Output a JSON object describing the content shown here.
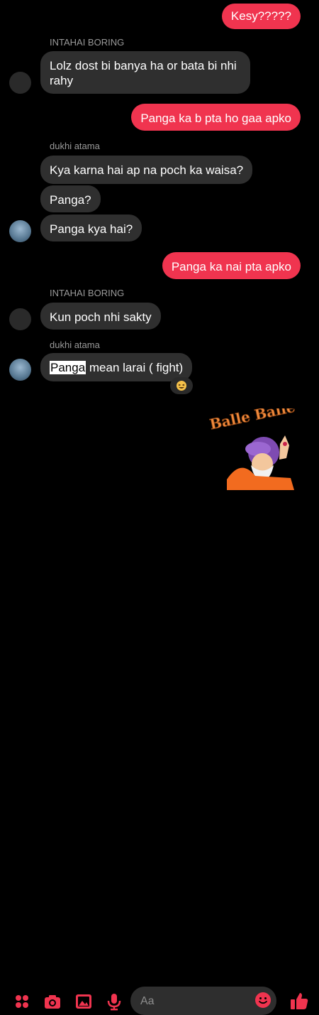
{
  "colors": {
    "accent": "#f0344f",
    "incoming_bubble": "#2f2f2f",
    "background": "#000000"
  },
  "messages": [
    {
      "text": "Kesy?????"
    },
    {
      "sender": "INTAHAI BORING",
      "text": "Lolz dost bi banya ha or bata bi nhi rahy"
    },
    {
      "text": "Panga ka b pta ho gaa apko"
    },
    {
      "sender": "dukhi atama",
      "text": "Kya karna hai ap na poch ka waisa?"
    },
    {
      "text": "Panga?"
    },
    {
      "text": "Panga kya hai?"
    },
    {
      "text": "Panga ka nai pta apko"
    },
    {
      "sender": "INTAHAI BORING",
      "text": "Kun poch nhi sakty"
    },
    {
      "sender": "dukhi atama",
      "highlight": "Panga",
      "rest": " mean larai ( fight)"
    }
  ],
  "reaction": {
    "icon": "laughing-emoji-icon"
  },
  "sticker": {
    "text": "Balle Balle"
  },
  "composer": {
    "placeholder": "Aa",
    "icons": [
      "grid-icon",
      "camera-icon",
      "gallery-icon",
      "microphone-icon",
      "emoji-icon",
      "thumbs-up-icon"
    ]
  }
}
